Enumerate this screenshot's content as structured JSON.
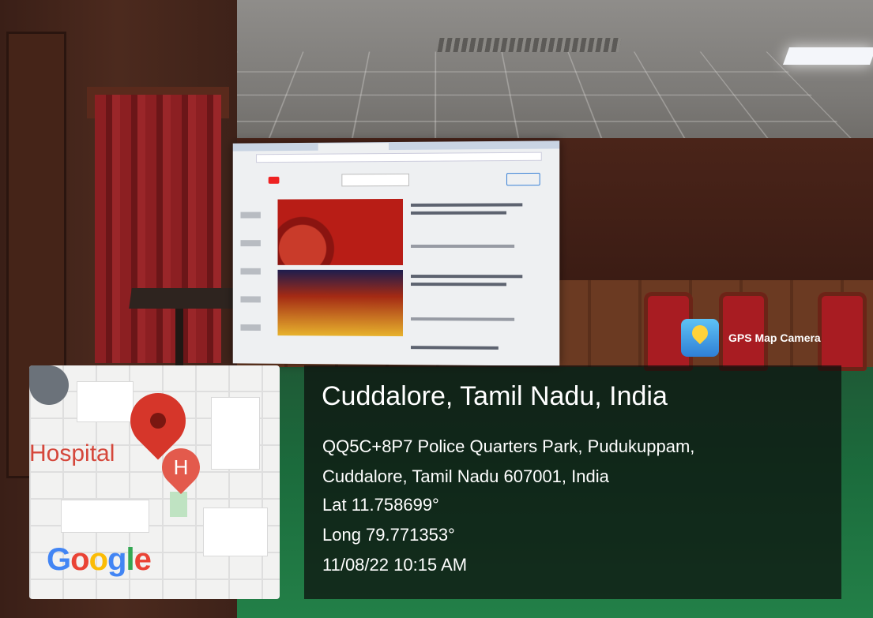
{
  "badge": {
    "label": "GPS Map Camera",
    "icon": "map-pin-icon"
  },
  "map": {
    "place_label": "Hospital",
    "marker_letter": "H",
    "logo_text": "Google",
    "pin_icon": "location-pin-icon",
    "school_icon": "school-icon"
  },
  "location": {
    "title": "Cuddalore, Tamil Nadu, India",
    "address_line1": "QQ5C+8P7 Police Quarters Park, Pudukuppam,",
    "address_line2": "Cuddalore, Tamil Nadu 607001, India",
    "latitude": "Lat 11.758699°",
    "longitude": "Long 79.771353°",
    "datetime": "11/08/22 10:15 AM"
  },
  "colors": {
    "pin_red": "#d6362a",
    "overlay_bg": "rgba(12,14,12,0.72)",
    "google_blue": "#4285f4",
    "google_red": "#ea4335",
    "google_yellow": "#fbbc05",
    "google_green": "#34a853"
  }
}
